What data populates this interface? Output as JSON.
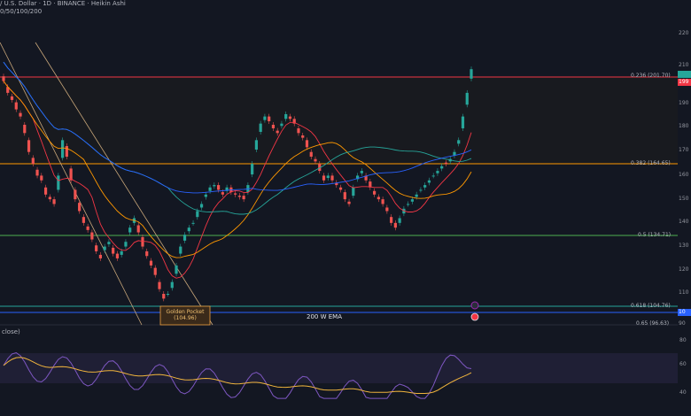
{
  "header": {
    "symbol_line": "/ U.S. Dollar · 1D · BINANCE · Heikin Ashi",
    "ma_line": "0/50/100/200"
  },
  "price_axis": {
    "ticks": [
      "220",
      "210",
      "190",
      "180",
      "170",
      "160",
      "150",
      "140",
      "130",
      "120",
      "110",
      "100",
      "90"
    ],
    "tag_current": "199",
    "tag_low": "10"
  },
  "rsi_axis": {
    "ticks": [
      "80",
      "60",
      "40"
    ]
  },
  "fib_levels": [
    {
      "label": "0.236 (201.70)",
      "color": "#f23645"
    },
    {
      "label": "0.382 (164.65)",
      "color": "#ff9800"
    },
    {
      "label": "0.5 (134.71)",
      "color": "#4caf50"
    },
    {
      "label": "0.618 (104.76)",
      "color": "#26a69a"
    },
    {
      "label": "0.65 (96.63)",
      "color": "#f23645"
    }
  ],
  "annotations": {
    "golden_pocket_title": "Golden Pocket",
    "golden_pocket_value": "(104.96)",
    "ema_label": "200 W EMA",
    "rsi_label": "close)"
  },
  "colors": {
    "background": "#131722",
    "bull": "#26a69a",
    "bear": "#ef5350",
    "rsi_line": "#7e57c2",
    "rsi_ma": "#f0b43c"
  }
}
